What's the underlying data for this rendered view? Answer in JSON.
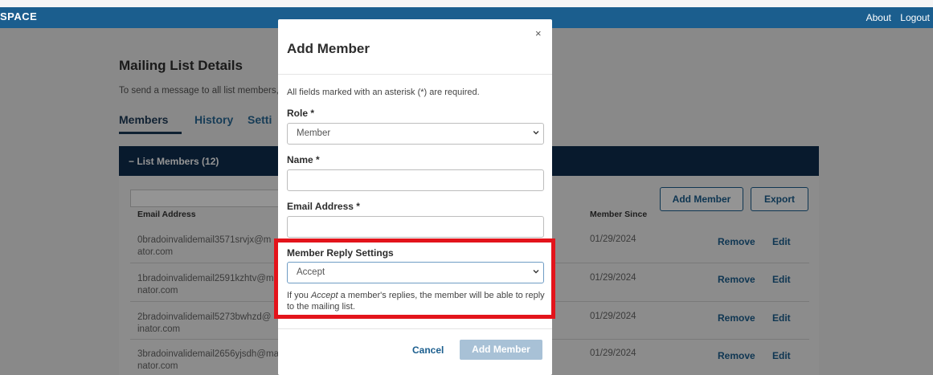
{
  "header": {
    "brand": "SPACE",
    "links": [
      "About",
      "Logout"
    ]
  },
  "page": {
    "title": "Mailing List Details",
    "subtitle": "To send a message to all list members,",
    "tabs": [
      "Members",
      "History",
      "Setti"
    ],
    "panel_title": "− List Members (12)",
    "buttons": {
      "add_member": "Add Member",
      "export": "Export"
    },
    "columns": {
      "email": "Email Address",
      "member_since": "Member Since"
    },
    "rows": [
      {
        "email_1": "0bradoinvalidemail3571srvjx@m",
        "email_2": "ator.com",
        "date": "01/29/2024",
        "remove": "Remove",
        "edit": "Edit"
      },
      {
        "email_1": "1bradoinvalidemail2591kzhtv@m",
        "email_2": "nator.com",
        "date": "01/29/2024",
        "remove": "Remove",
        "edit": "Edit"
      },
      {
        "email_1": "2bradoinvalidemail5273bwhzd@",
        "email_2": "inator.com",
        "date": "01/29/2024",
        "remove": "Remove",
        "edit": "Edit"
      },
      {
        "email_1": "3bradoinvalidemail2656yjsdh@ma",
        "email_2": "nator.com",
        "date": "01/29/2024",
        "remove": "Remove",
        "edit": "Edit"
      }
    ]
  },
  "modal": {
    "title": "Add Member",
    "close": "×",
    "note": "All fields marked with an asterisk (*) are required.",
    "role_label": "Role *",
    "role_value": "Member",
    "name_label": "Name *",
    "name_value": "",
    "email_label": "Email Address *",
    "email_value": "",
    "reply_label": "Member Reply Settings",
    "reply_value": "Accept",
    "help_prefix": "If you ",
    "help_em": "Accept",
    "help_suffix": " a member's replies, the member will be able to reply to the mailing list.",
    "cancel": "Cancel",
    "submit": "Add Member"
  },
  "colors": {
    "accent": "#1b5e8e",
    "header": "#0f2d4f",
    "highlight": "#e3141b",
    "disabled": "#a8c1d6"
  }
}
